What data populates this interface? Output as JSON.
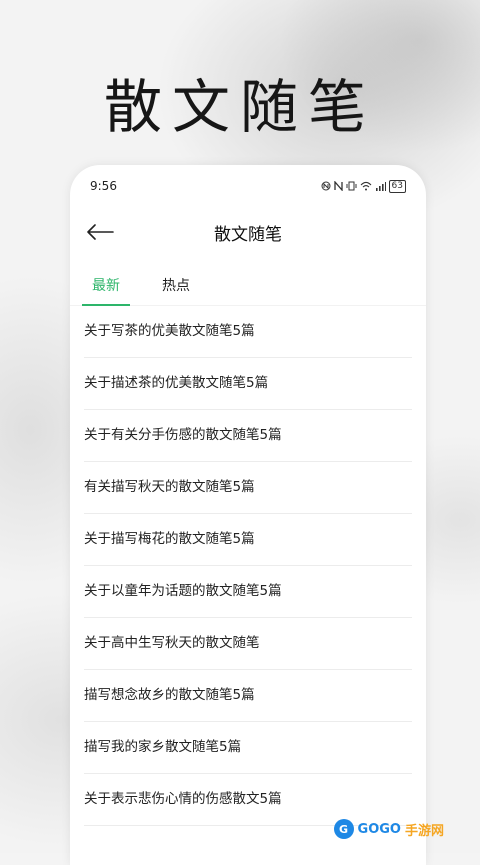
{
  "hero": {
    "title": "散文随笔"
  },
  "status_bar": {
    "time": "9:56",
    "battery": "63"
  },
  "navbar": {
    "title": "散文随笔"
  },
  "tabs": [
    {
      "label": "最新",
      "active": true
    },
    {
      "label": "热点",
      "active": false
    }
  ],
  "articles": [
    "关于写茶的优美散文随笔5篇",
    "关于描述茶的优美散文随笔5篇",
    "关于有关分手伤感的散文随笔5篇",
    "有关描写秋天的散文随笔5篇",
    "关于描写梅花的散文随笔5篇",
    "关于以童年为话题的散文随笔5篇",
    "关于高中生写秋天的散文随笔",
    "描写想念故乡的散文随笔5篇",
    "描写我的家乡散文随笔5篇",
    "关于表示悲伤心情的伤感散文5篇"
  ],
  "watermark": {
    "part_a": "GOGO",
    "part_b": "手游网",
    "logo": "G"
  },
  "colors": {
    "accent": "#2db56a",
    "background": "#f3f3f3"
  }
}
